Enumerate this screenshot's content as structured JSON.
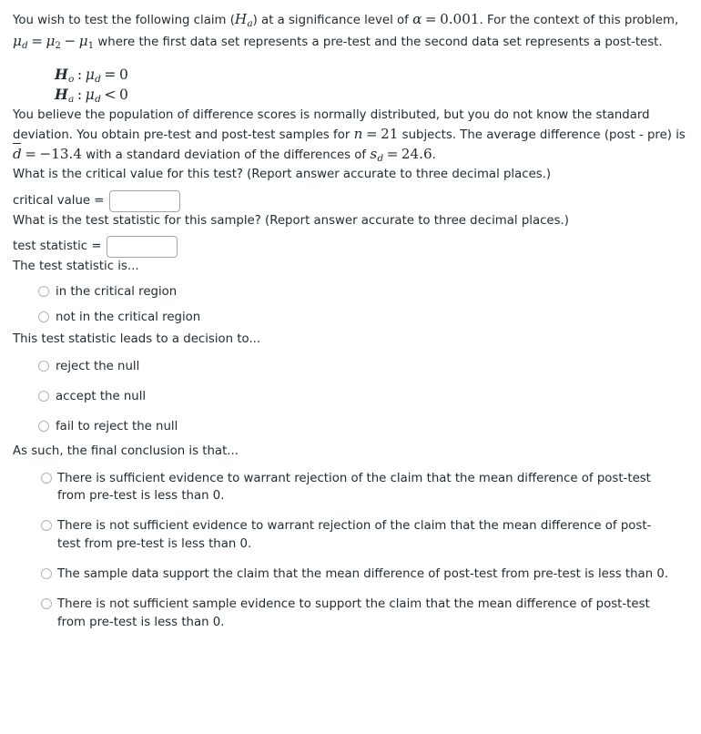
{
  "intro": {
    "part1": "You wish to test the following claim (",
    "ha_sym": "H",
    "ha_sub": "a",
    "part2": ") at a significance level of ",
    "alpha_sym": "α",
    "eq": "=",
    "alpha_value": "0.001",
    "part3": ". For the context of this problem, ",
    "mu_sym": "μ",
    "mu_d_sub": "d",
    "mu_2_sub": "2",
    "minus": "−",
    "mu_1_sub": "1",
    "part4": " where the first data set represents a pre-test and the second data set represents a post-test."
  },
  "hypotheses": {
    "null_label": "H",
    "null_sub": "o",
    "alt_label": "H",
    "alt_sub": "a",
    "colon": ":",
    "mu": "μ",
    "mu_sub": "d",
    "null_rel": "=",
    "alt_rel": "<",
    "value": "0"
  },
  "sample": {
    "part1": "You believe the population of difference scores is normally distributed, but you do not know the standard deviation. You obtain pre-test and post-test samples for ",
    "n_sym": "n",
    "eq": "=",
    "n_value": "21",
    "part2": " subjects. The average difference (post - pre) is ",
    "dbar_sym": "d",
    "dbar_value": "−13.4",
    "part3": " with a standard deviation of the differences of ",
    "s_sym": "s",
    "s_sub": "d",
    "s_value": "24.6",
    "period": "."
  },
  "critical_value": {
    "question": "What is the critical value for this test? (Report answer accurate to three decimal places.)",
    "label": "critical value =",
    "value": "",
    "placeholder": ""
  },
  "test_statistic": {
    "question": "What is the test statistic for this sample? (Report answer accurate to three decimal places.)",
    "label": "test statistic =",
    "value": "",
    "placeholder": ""
  },
  "region_question": {
    "prompt": "The test statistic is...",
    "options": [
      "in the critical region",
      "not in the critical region"
    ]
  },
  "decision_question": {
    "prompt": "This test statistic leads to a decision to...",
    "options": [
      "reject the null",
      "accept the null",
      "fail to reject the null"
    ]
  },
  "conclusion_question": {
    "prompt": "As such, the final conclusion is that...",
    "options": [
      "There is sufficient evidence to warrant rejection of the claim that the mean difference of post-test from pre-test is less than 0.",
      "There is not sufficient evidence to warrant rejection of the claim that the mean difference of post-test from pre-test is less than 0.",
      "The sample data support the claim that the mean difference of post-test from pre-test is less than 0.",
      "There is not sufficient sample evidence to support the claim that the mean difference of post-test from pre-test is less than 0."
    ]
  }
}
